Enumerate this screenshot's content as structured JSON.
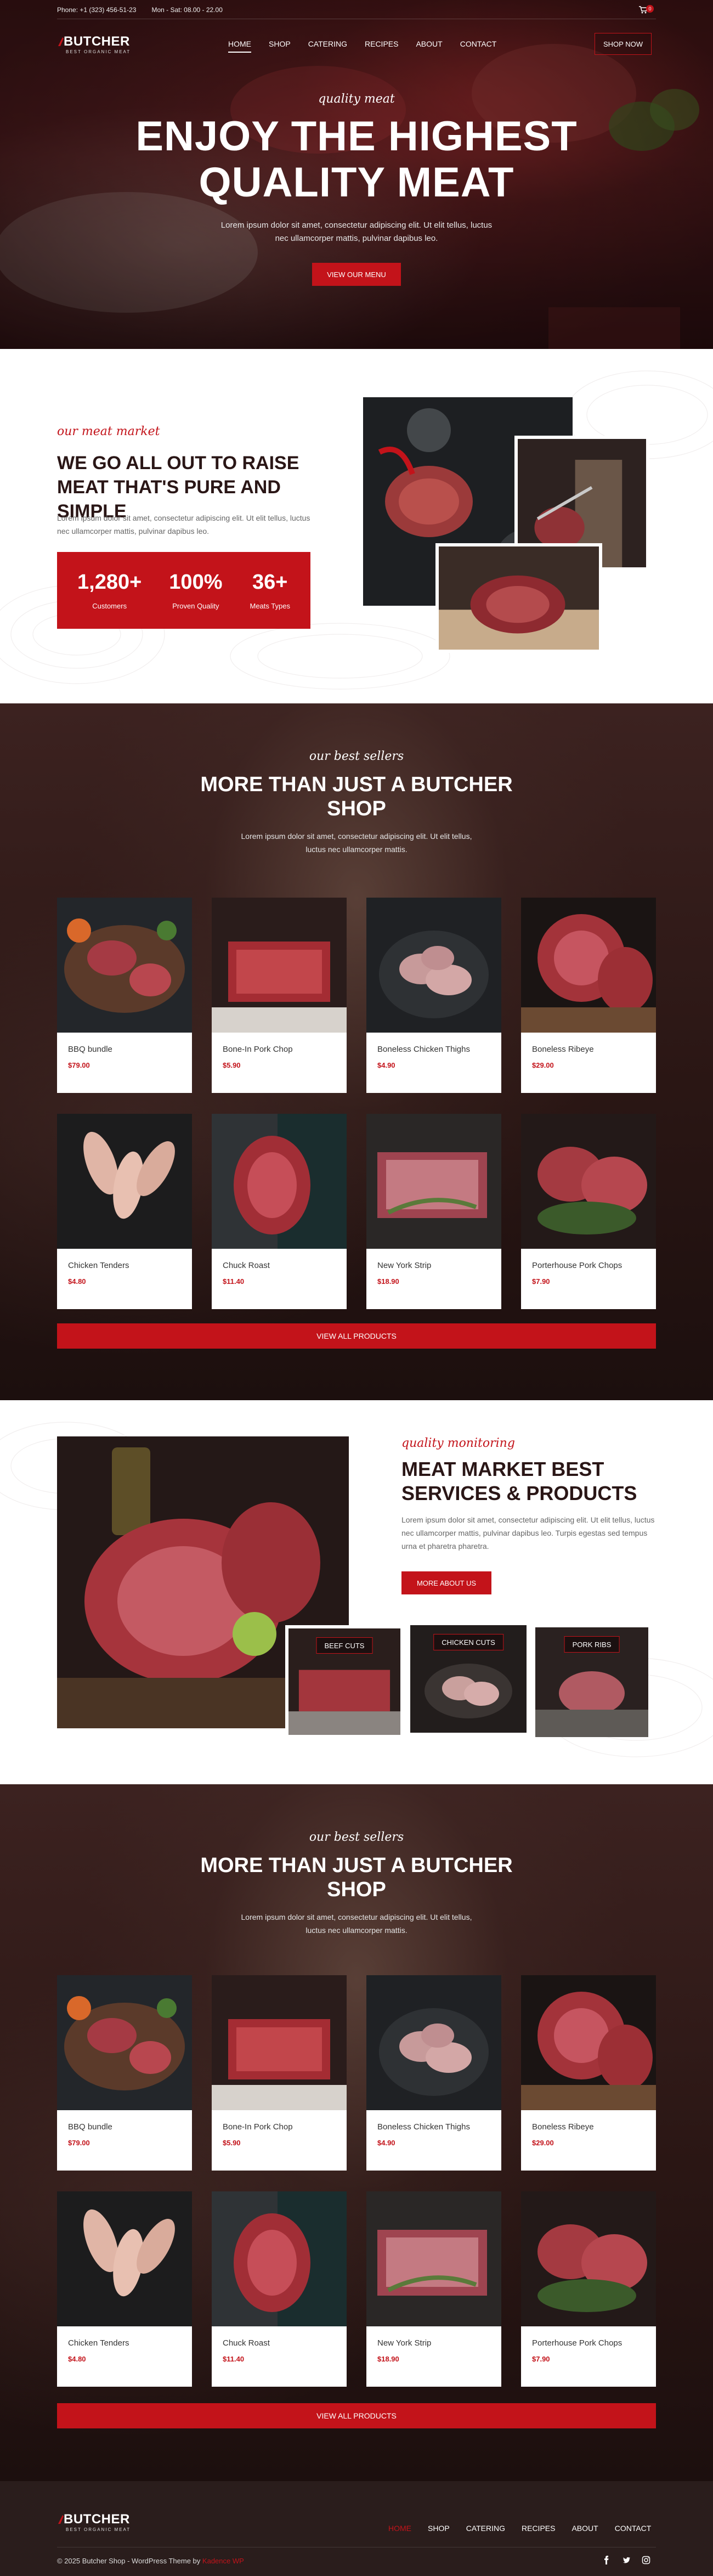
{
  "topbar": {
    "phone": "Phone: +1 (323) 456-51-23",
    "hours": "Mon - Sat: 08.00 - 22.00",
    "cart_count": "0"
  },
  "brand": {
    "name": "BUTCHER",
    "tagline": "BEST ORGANIC MEAT"
  },
  "nav": {
    "items": [
      "HOME",
      "SHOP",
      "CATERING",
      "RECIPES",
      "ABOUT",
      "CONTACT"
    ],
    "shop_now": "SHOP NOW"
  },
  "hero": {
    "script": "quality meat",
    "title_line1": "ENJOY THE HIGHEST",
    "title_line2": "QUALITY MEAT",
    "text": "Lorem ipsum dolor sit amet, consectetur adipiscing elit. Ut elit tellus, luctus nec ullamcorper mattis, pulvinar dapibus leo.",
    "button": "VIEW OUR MENU"
  },
  "about": {
    "script": "our meat market",
    "title": "WE GO ALL OUT TO RAISE MEAT THAT'S PURE AND SIMPLE",
    "text": "Lorem ipsum dolor sit amet, consectetur adipiscing elit. Ut elit tellus, luctus nec ullamcorper mattis, pulvinar dapibus leo.",
    "stats": [
      {
        "value": "1,280+",
        "label": "Customers"
      },
      {
        "value": "100%",
        "label": "Proven Quality"
      },
      {
        "value": "36+",
        "label": "Meats Types"
      }
    ]
  },
  "bestsellers": {
    "script": "our best sellers",
    "title": "MORE THAN JUST A BUTCHER SHOP",
    "text": "Lorem ipsum dolor sit amet, consectetur adipiscing elit. Ut elit tellus, luctus nec ullamcorper mattis.",
    "products": [
      {
        "name": "BBQ bundle",
        "price": "$79.00"
      },
      {
        "name": "Bone-In Pork Chop",
        "price": "$5.90"
      },
      {
        "name": "Boneless Chicken Thighs",
        "price": "$4.90"
      },
      {
        "name": "Boneless Ribeye",
        "price": "$29.00"
      },
      {
        "name": "Chicken Tenders",
        "price": "$4.80"
      },
      {
        "name": "Chuck Roast",
        "price": "$11.40"
      },
      {
        "name": "New York Strip",
        "price": "$18.90"
      },
      {
        "name": "Porterhouse Pork Chops",
        "price": "$7.90"
      }
    ],
    "view_all": "VIEW ALL PRODUCTS"
  },
  "services": {
    "script": "quality monitoring",
    "title": "MEAT MARKET BEST SERVICES & PRODUCTS",
    "text": "Lorem ipsum dolor sit amet, consectetur adipiscing elit. Ut elit tellus, luctus nec ullamcorper mattis, pulvinar dapibus leo. Turpis egestas sed tempus urna et pharetra pharetra.",
    "button": "MORE ABOUT US",
    "cards": [
      "BEEF CUTS",
      "CHICKEN CUTS",
      "PORK RIBS"
    ]
  },
  "footer": {
    "menu": [
      "HOME",
      "SHOP",
      "CATERING",
      "RECIPES",
      "ABOUT",
      "CONTACT"
    ],
    "copyright": "© 2025 Butcher Shop - WordPress Theme by",
    "author": "Kadence WP"
  },
  "colors": {
    "accent": "#c3131a",
    "dark": "#2a1616",
    "footer": "#2a1d1c"
  }
}
